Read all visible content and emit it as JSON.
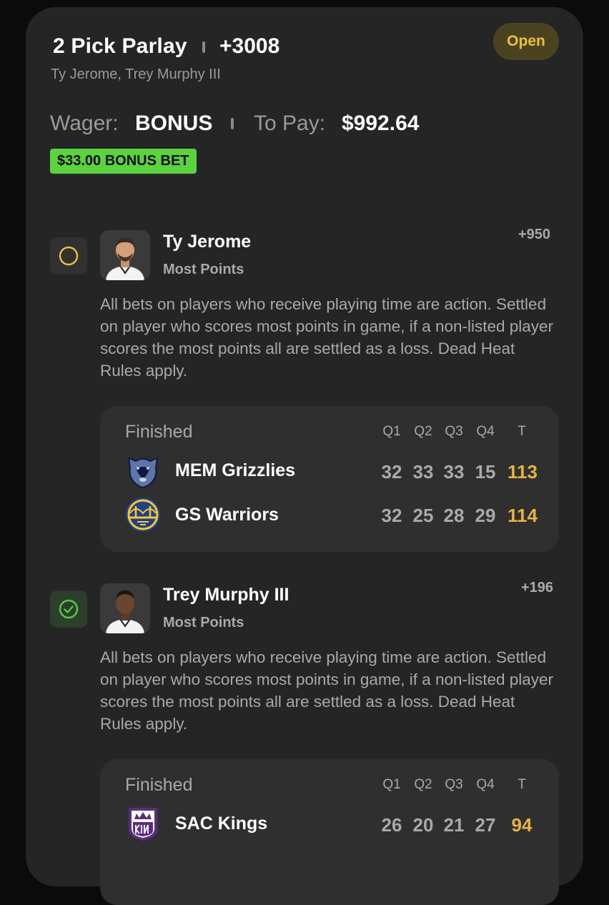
{
  "bet": {
    "title": "2 Pick Parlay",
    "odds": "+3008",
    "players": "Ty Jerome, Trey Murphy III",
    "status": "Open",
    "wager_label": "Wager:",
    "wager_value": "BONUS",
    "topay_label": "To Pay:",
    "topay_value": "$992.64",
    "bonus_tag": "$33.00 BONUS BET"
  },
  "legs": [
    {
      "player": "Ty Jerome",
      "market": "Most Points",
      "odds": "+950",
      "rules": "All bets on players who receive playing time are action. Settled on player who scores most points in game, if a non-listed player scores the most points all are settled as a loss. Dead Heat Rules apply.",
      "game": {
        "status": "Finished",
        "headers": [
          "Q1",
          "Q2",
          "Q3",
          "Q4",
          "T"
        ],
        "teams": [
          {
            "name": "MEM Grizzlies",
            "scores": [
              "32",
              "33",
              "33",
              "15"
            ],
            "total": "113",
            "logo": "grizzlies-logo"
          },
          {
            "name": "GS Warriors",
            "scores": [
              "32",
              "25",
              "28",
              "29"
            ],
            "total": "114",
            "logo": "warriors-logo"
          }
        ]
      }
    },
    {
      "player": "Trey Murphy III",
      "market": "Most Points",
      "odds": "+196",
      "rules": "All bets on players who receive playing time are action. Settled on player who scores most points in game, if a non-listed player scores the most points all are settled as a loss. Dead Heat Rules apply.",
      "game": {
        "status": "Finished",
        "headers": [
          "Q1",
          "Q2",
          "Q3",
          "Q4",
          "T"
        ],
        "teams": [
          {
            "name": "SAC Kings",
            "scores": [
              "26",
              "20",
              "21",
              "27"
            ],
            "total": "94",
            "logo": "kings-logo"
          }
        ]
      }
    }
  ],
  "colors": {
    "background": "#0b0b0b",
    "card": "#252526",
    "accent_gold": "#e9b33b",
    "bonus_green": "#5bd33f",
    "win_green": "#4fcf3f"
  }
}
